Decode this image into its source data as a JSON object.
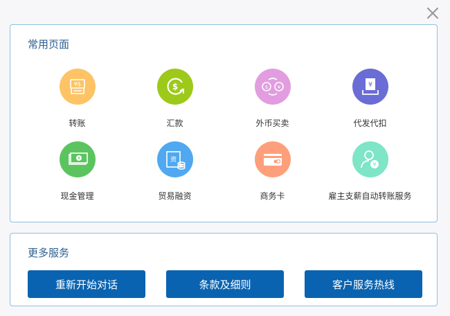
{
  "close_button": {
    "icon": "close-icon"
  },
  "common_pages": {
    "title": "常用页面",
    "items": [
      {
        "label": "转账",
        "icon": "transfer-icon",
        "color": "#fdc365"
      },
      {
        "label": "汇款",
        "icon": "remittance-icon",
        "color": "#9dc91a"
      },
      {
        "label": "外币买卖",
        "icon": "currency-exchange-icon",
        "color": "#e29de0"
      },
      {
        "label": "代发代扣",
        "icon": "payroll-icon",
        "color": "#6a6dd5"
      },
      {
        "label": "现金管理",
        "icon": "cash-management-icon",
        "color": "#5cc45f"
      },
      {
        "label": "贸易融资",
        "icon": "trade-finance-icon",
        "color": "#4fa8f0"
      },
      {
        "label": "商务卡",
        "icon": "business-card-icon",
        "color": "#fe9f7c"
      },
      {
        "label": "雇主支薪自动转账服务",
        "icon": "employer-payroll-icon",
        "color": "#7ee5c6"
      }
    ]
  },
  "more_services": {
    "title": "更多服务",
    "buttons": [
      {
        "label": "重新开始对话"
      },
      {
        "label": "条款及细则"
      },
      {
        "label": "客户服务热线"
      }
    ]
  }
}
